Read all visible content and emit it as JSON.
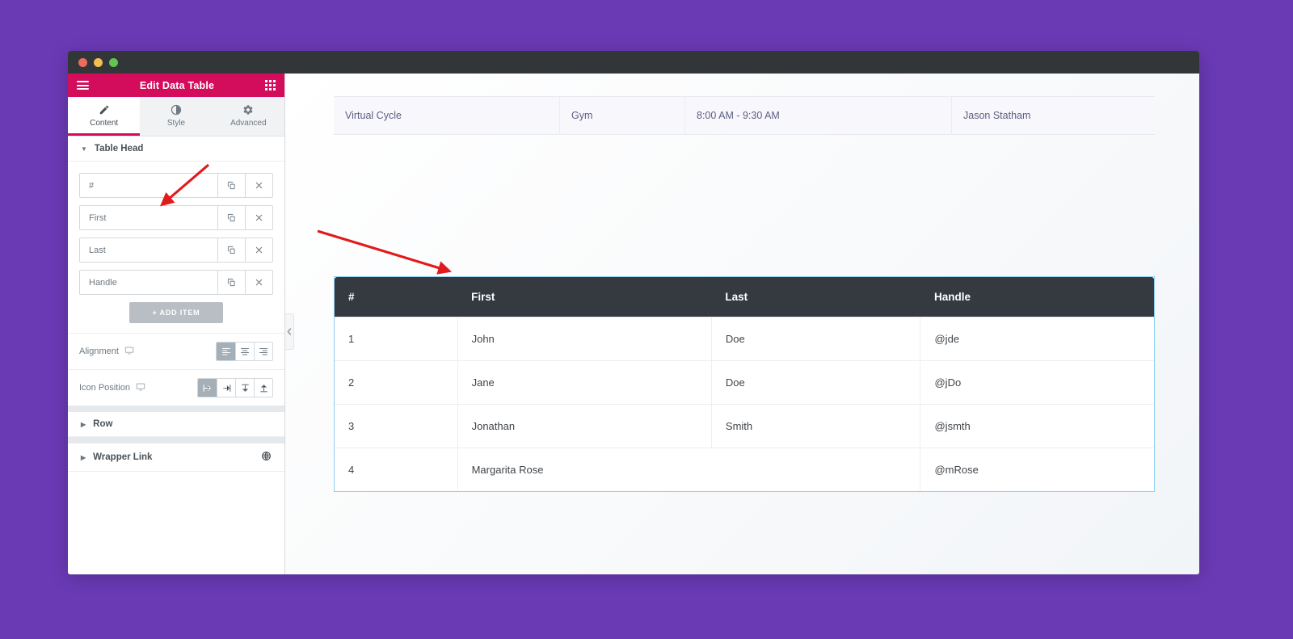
{
  "window": {
    "traffic_lights": [
      "close",
      "minimize",
      "maximize"
    ]
  },
  "panel": {
    "title": "Edit Data Table",
    "menu_icon": "hamburger-icon",
    "grid_icon": "grid-apps-icon",
    "tabs": [
      {
        "label": "Content",
        "icon": "pencil-icon",
        "active": true
      },
      {
        "label": "Style",
        "icon": "contrast-icon",
        "active": false
      },
      {
        "label": "Advanced",
        "icon": "gear-icon",
        "active": false
      }
    ],
    "sections": [
      {
        "label": "Table Head",
        "expanded": true
      },
      {
        "label": "Row",
        "expanded": false
      },
      {
        "label": "Wrapper Link",
        "expanded": false,
        "icon": "globe-link-icon"
      }
    ],
    "table_head_items": [
      {
        "label": "#"
      },
      {
        "label": "First"
      },
      {
        "label": "Last"
      },
      {
        "label": "Handle"
      }
    ],
    "item_actions": {
      "duplicate": "duplicate-icon",
      "remove": "close-icon"
    },
    "add_item_label": "+   ADD ITEM",
    "controls": [
      {
        "label": "Alignment",
        "responsive_icon": "desktop-icon",
        "options": [
          "align-left",
          "align-center",
          "align-right"
        ],
        "active_index": 0
      },
      {
        "label": "Icon Position",
        "responsive_icon": "desktop-icon",
        "options": [
          "icon-left",
          "icon-right",
          "icon-top",
          "icon-bottom"
        ],
        "active_index": 0
      }
    ]
  },
  "canvas": {
    "collapse_icon": "chevron-left-icon",
    "top_partial_row": {
      "cells": [
        "Virtual Cycle",
        "Gym",
        "8:00 AM - 9:30 AM",
        "Jason Statham"
      ],
      "widths": [
        280,
        155,
        330,
        251
      ]
    },
    "data_table": {
      "headers": [
        "#",
        "First",
        "Last",
        "Handle"
      ],
      "column_widths": [
        "15%",
        "31%",
        "25.5%",
        "28.5%"
      ],
      "rows": [
        [
          "1",
          "John",
          "Doe",
          "@jde"
        ],
        [
          "2",
          "Jane",
          "Doe",
          "@jDo"
        ],
        [
          "3",
          "Jonathan",
          "Smith",
          "@jsmth"
        ],
        [
          "4",
          "Margarita Rose",
          "",
          "@mRose"
        ]
      ]
    }
  },
  "annotations": {
    "arrows": [
      {
        "name": "arrow-to-first-head-item",
        "color": "#e01b1b"
      },
      {
        "name": "arrow-to-first-column-header",
        "color": "#e01b1b"
      }
    ]
  },
  "colors": {
    "page_background": "#6a3ab5",
    "panel_header": "#d30c5c",
    "table_header": "#343a40",
    "selection_border": "#8ecdf0",
    "accent_red": "#e01b1b"
  }
}
